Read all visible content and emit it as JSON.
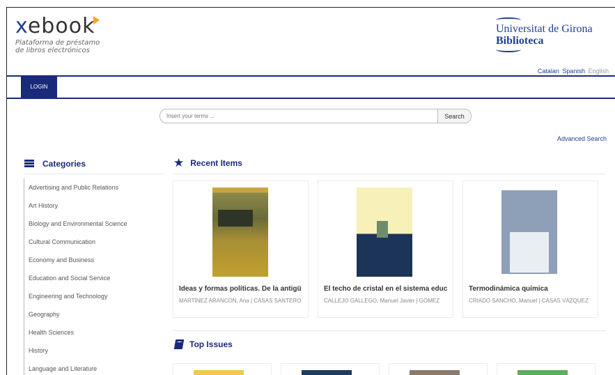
{
  "header": {
    "logo_text": "xebook",
    "logo_subtitle_1": "Plataforma de préstamo",
    "logo_subtitle_2": "de libros electrónicos",
    "institution_name": "Universitat de Girona",
    "institution_unit": "Biblioteca",
    "languages": [
      "Catalan",
      "Spanish",
      "English"
    ],
    "active_language": "English"
  },
  "nav": {
    "login_label": "LOGIN"
  },
  "search": {
    "placeholder": "Insert your terms ...",
    "button_label": "Search",
    "advanced_label": "Advanced Search"
  },
  "categories": {
    "title": "Categories",
    "items": [
      "Advertising and Public Relations",
      "Art History",
      "Biology and Environmental Science",
      "Cultural Communication",
      "Economy and Business",
      "Education and Social Service",
      "Engineering and Technology",
      "Geography",
      "Health Sciences",
      "History",
      "Language and Literature"
    ]
  },
  "recent": {
    "title": "Recent Items",
    "items": [
      {
        "title": "Ideas y formas políticas. De la antigü",
        "authors": "MARTÍNEZ ARANCÓN, Ana | CASAS SANTERO"
      },
      {
        "title": "El techo de cristal en el sistema educ",
        "authors": "CALLEJO GALLEGO, Manuel Javier | GÓMEZ"
      },
      {
        "title": "Termodinámica química",
        "authors": "CRIADO SANCHO, Manuel | CASAS VÁZQUEZ"
      }
    ]
  },
  "top": {
    "title": "Top Issues"
  },
  "colors": {
    "brand": "#1a2a7a",
    "accent": "#f5a623"
  }
}
